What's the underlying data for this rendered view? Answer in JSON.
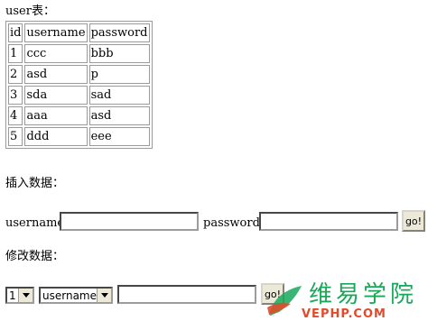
{
  "table_title": "user表：",
  "users_table": {
    "columns": [
      "id",
      "username",
      "password"
    ],
    "rows": [
      [
        "1",
        "ccc",
        "bbb"
      ],
      [
        "2",
        "asd",
        "p"
      ],
      [
        "3",
        "sda",
        "sad"
      ],
      [
        "4",
        "aaa",
        "asd"
      ],
      [
        "5",
        "ddd",
        "eee"
      ]
    ]
  },
  "insert_section": {
    "title": "插入数据：",
    "username_label": "username:",
    "username_value": "",
    "password_label": "password:",
    "password_value": "",
    "go_label": "go!"
  },
  "update_section": {
    "title": "修改数据：",
    "id_select_value": "1",
    "field_select_value": "username",
    "value_input": "",
    "go_label": "go!"
  },
  "watermark": {
    "chinese": "维易学院",
    "english": "VEPHP.COM",
    "color_green": "#19a85a",
    "color_red": "#e14b2b"
  }
}
